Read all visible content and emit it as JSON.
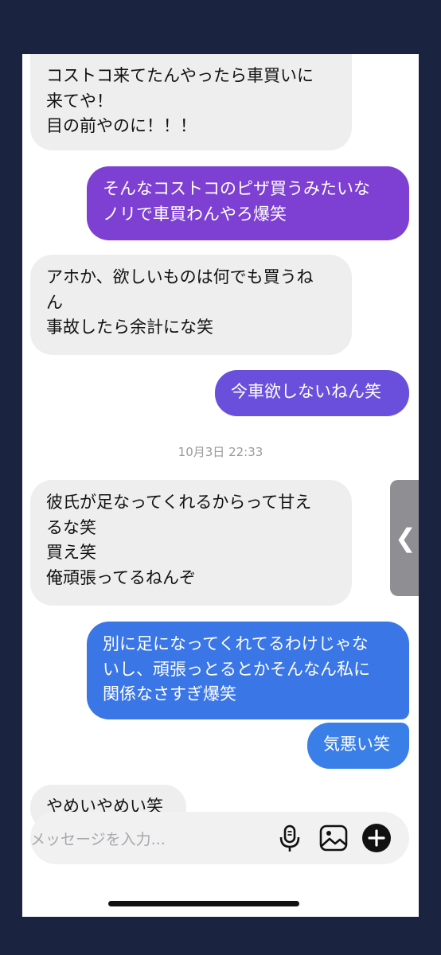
{
  "messages": [
    {
      "side": "received",
      "text": "コストコ来てたんやったら車買いに\n来てや！\n目の前やのに！！！"
    },
    {
      "side": "sent",
      "color": "#7e3fd3",
      "text": "そんなコストコのピザ買うみたいな\nノリで車買わんやろ爆笑"
    },
    {
      "side": "received",
      "text": "アホか、欲しいものは何でも買うね\nん\n事故したら余計にな笑"
    },
    {
      "side": "sent",
      "color": "#6a4fdc",
      "text": "今車欲しないねん笑"
    },
    {
      "side": "received",
      "text": "彼氏が足なってくれるからって甘え\nるな笑\n買え笑\n俺頑張ってるねんぞ"
    },
    {
      "side": "sent",
      "color": "#3a76e6",
      "text": "別に足になってくれてるわけじゃな\nいし、頑張っとるとかそんなん私に\n関係なさすぎ爆笑"
    },
    {
      "side": "sent",
      "color": "#3a7fe8",
      "text": "気悪い笑"
    },
    {
      "side": "received",
      "text": "やめいやめい笑"
    }
  ],
  "timestamp": "10月3日 22:33",
  "composer": {
    "placeholder": "メッセージを入力...",
    "icons": [
      "microphone-icon",
      "image-icon",
      "plus-icon"
    ]
  },
  "side_tab": {
    "icon": "chevron-left-icon",
    "glyph": "❮"
  },
  "colors": {
    "frame": "#1a2340",
    "received_bubble": "#eeeeef",
    "timestamp": "#9a9a9f"
  }
}
